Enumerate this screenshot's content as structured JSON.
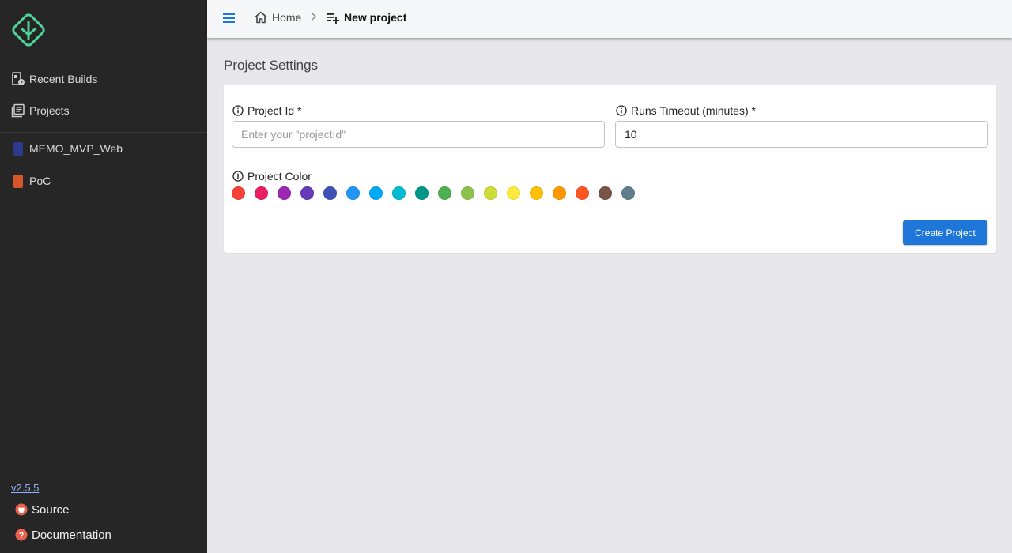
{
  "sidebar": {
    "nav": [
      {
        "label": "Recent Builds",
        "icon": "recent-builds-icon"
      },
      {
        "label": "Projects",
        "icon": "projects-icon"
      }
    ],
    "projects": [
      {
        "label": "MEMO_MVP_Web",
        "color": "#2b3a8a"
      },
      {
        "label": "PoC",
        "color": "#d4562a"
      }
    ],
    "version": "v2.5.5",
    "footer": [
      {
        "label": "Source",
        "icon": "github-icon"
      },
      {
        "label": "Documentation",
        "icon": "help-icon"
      }
    ]
  },
  "topbar": {
    "breadcrumb": [
      {
        "label": "Home",
        "icon": "home-icon"
      },
      {
        "label": "New project",
        "icon": "playlist-add-icon"
      }
    ]
  },
  "main": {
    "title": "Project Settings",
    "project_id": {
      "label": "Project Id *",
      "placeholder": "Enter your \"projectId\"",
      "value": ""
    },
    "runs_timeout": {
      "label": "Runs Timeout (minutes) *",
      "value": "10"
    },
    "project_color": {
      "label": "Project Color",
      "colors": [
        "#f44336",
        "#e91e63",
        "#9c27b0",
        "#673ab7",
        "#3f51b5",
        "#2196f3",
        "#03a9f4",
        "#00bcd4",
        "#009688",
        "#4caf50",
        "#8bc34a",
        "#cddc39",
        "#ffeb3b",
        "#ffc107",
        "#ff9800",
        "#ff5722",
        "#795548",
        "#607d8b"
      ]
    },
    "create_button": "Create Project"
  },
  "theme": {
    "accent": "#1e77d8",
    "sidebar_bg": "#262626",
    "logo_green": "#4fd19a"
  }
}
